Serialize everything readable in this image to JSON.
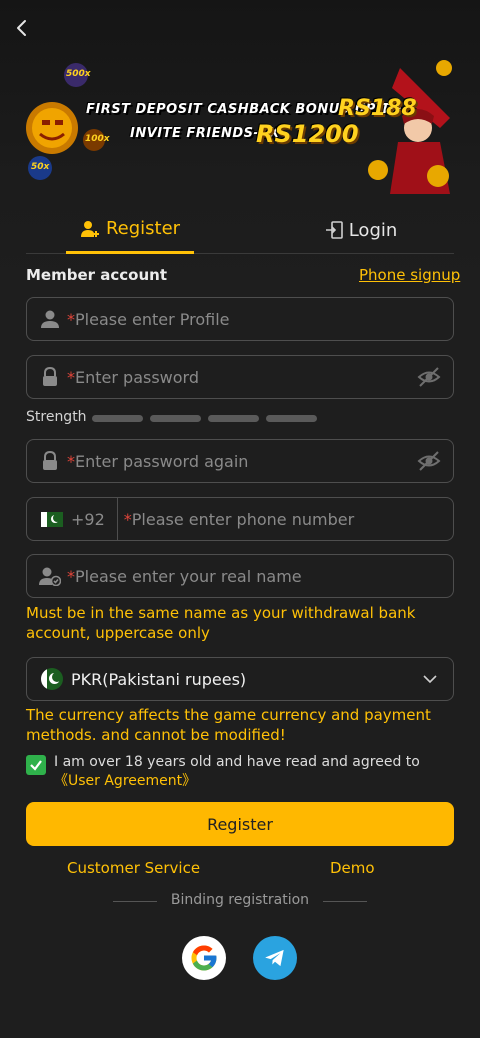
{
  "banner": {
    "line1": "FIRST DEPOSIT CASHBACK BONUS UP TO",
    "amount1": "RS188",
    "line2": "INVITE FRIENDS-1X",
    "amount2": "RS1200",
    "chip1": "500x",
    "chip2": "100x",
    "chip3": "50x"
  },
  "tabs": {
    "register": "Register",
    "login": "Login"
  },
  "form": {
    "member_label": "Member account",
    "phone_signup": "Phone signup",
    "profile_placeholder": "Please enter Profile",
    "password_placeholder": "Enter password",
    "strength_label": "Strength",
    "password_again_placeholder": "Enter password again",
    "country_code": "+92",
    "phone_placeholder": "Please enter phone number",
    "realname_placeholder": "Please enter your real name",
    "realname_warning": "Must be in the same name as your withdrawal bank account, uppercase only",
    "currency_value": "PKR(Pakistani rupees)",
    "currency_warning": "The currency affects the game currency and payment methods. and cannot be modified!",
    "agree_text": "I am over 18 years old and have read and agreed to",
    "agree_link": "《User Agreement》",
    "agree_checked": true,
    "submit": "Register",
    "required_mark": "*"
  },
  "footer": {
    "customer_service": "Customer Service",
    "demo": "Demo",
    "binding": "Binding registration"
  },
  "colors": {
    "accent": "#ffc107",
    "button": "#ffb800",
    "background": "#1e1e1e",
    "required": "#e0453a",
    "checkbox": "#2fb14b",
    "telegram": "#2aa3e0"
  },
  "icons": {
    "back": "chevron-left-icon",
    "register_tab": "add-user-icon",
    "login_tab": "login-door-icon",
    "profile": "user-icon",
    "password": "lock-icon",
    "eye": "eye-off-icon",
    "realname": "user-check-icon",
    "dropdown": "chevron-down-icon",
    "google": "google-icon",
    "telegram": "telegram-icon"
  }
}
